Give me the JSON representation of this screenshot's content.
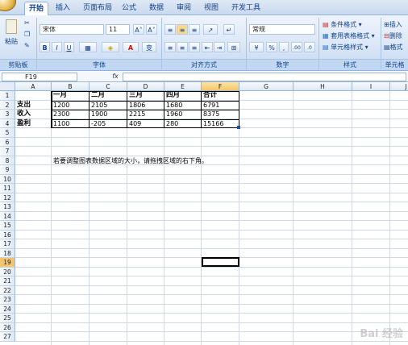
{
  "ribbon_tabs": [
    "开始",
    "插入",
    "页面布局",
    "公式",
    "数据",
    "审阅",
    "视图",
    "开发工具"
  ],
  "active_tab_index": 0,
  "clipboard": {
    "paste_label": "粘贴",
    "group_label": "剪贴板"
  },
  "font": {
    "name": "宋体",
    "size": "11",
    "bold": "B",
    "italic": "I",
    "underline": "U",
    "grow": "A˄",
    "shrink": "A˅",
    "color_letter": "A",
    "wen": "变",
    "group_label": "字体"
  },
  "alignment": {
    "group_label": "对齐方式"
  },
  "number": {
    "format": "常规",
    "percent": "%",
    "comma": ",",
    "inc_decimal": ".0→.00",
    "dec_decimal": ".00→.0",
    "group_label": "数字"
  },
  "styles": {
    "conditional": "条件格式",
    "table": "套用表格格式",
    "cell": "单元格样式",
    "group_label": "样式"
  },
  "cells_group": {
    "insert": "插入",
    "delete": "删除",
    "format": "格式",
    "group_label": "单元格"
  },
  "formula_bar": {
    "name_box": "F19",
    "fx": "fx",
    "content": ""
  },
  "columns": [
    "A",
    "B",
    "C",
    "D",
    "E",
    "F",
    "G",
    "H",
    "I",
    "J"
  ],
  "selected_column": "F",
  "rows": [
    "1",
    "2",
    "3",
    "4",
    "5",
    "6",
    "7",
    "8",
    "9",
    "10",
    "11",
    "12",
    "13",
    "14",
    "15",
    "16",
    "17",
    "18",
    "19",
    "20",
    "21",
    "22",
    "23",
    "24",
    "25",
    "26",
    "27"
  ],
  "selected_row": "19",
  "table": {
    "header": [
      "",
      "一月",
      "二月",
      "三月",
      "四月",
      "合计"
    ],
    "rows": [
      [
        "支出",
        "1200",
        "2105",
        "1806",
        "1680",
        "6791"
      ],
      [
        "收入",
        "2300",
        "1900",
        "2215",
        "1960",
        "8375"
      ],
      [
        "盈利",
        "1100",
        "-205",
        "409",
        "280",
        "15166"
      ]
    ]
  },
  "note": "若要调整图表数据区域的大小，请拖拽区域的右下角。",
  "watermark": "Bai 经验"
}
